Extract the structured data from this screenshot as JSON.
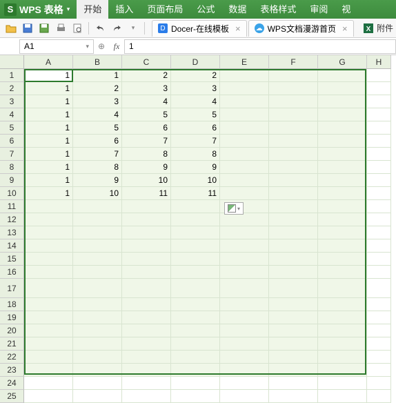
{
  "app": {
    "logo_letter": "S",
    "name": "WPS 表格",
    "dropdown": "▾"
  },
  "menu": [
    "开始",
    "插入",
    "页面布局",
    "公式",
    "数据",
    "表格样式",
    "审阅",
    "视"
  ],
  "toolbar_icons": [
    "folder-open",
    "save",
    "save-as",
    "print",
    "print-preview",
    "undo",
    "redo"
  ],
  "doc_tabs": [
    {
      "icon_bg": "#2b7de9",
      "icon_text": "D",
      "label": "Docer-在线模板",
      "close": "×"
    },
    {
      "icon_bg": "#3aa3e8",
      "icon_text": "☁",
      "label": "WPS文档漫游首页",
      "close": "×"
    }
  ],
  "attach_label": "附件",
  "namebox": {
    "value": "A1",
    "dd": "▾"
  },
  "fx_label": "fx",
  "formula_value": "1",
  "columns": [
    "A",
    "B",
    "C",
    "D",
    "E",
    "F",
    "G",
    "H"
  ],
  "row_numbers": [
    1,
    2,
    3,
    4,
    5,
    6,
    7,
    8,
    9,
    10,
    11,
    12,
    13,
    14,
    15,
    16,
    17,
    18,
    19,
    20,
    21,
    22,
    23,
    24,
    25
  ],
  "tall_row": 17,
  "cells": {
    "1": {
      "A": 1,
      "B": 1,
      "C": 2,
      "D": 2
    },
    "2": {
      "A": 1,
      "B": 2,
      "C": 3,
      "D": 3
    },
    "3": {
      "A": 1,
      "B": 3,
      "C": 4,
      "D": 4
    },
    "4": {
      "A": 1,
      "B": 4,
      "C": 5,
      "D": 5
    },
    "5": {
      "A": 1,
      "B": 5,
      "C": 6,
      "D": 6
    },
    "6": {
      "A": 1,
      "B": 6,
      "C": 7,
      "D": 7
    },
    "7": {
      "A": 1,
      "B": 7,
      "C": 8,
      "D": 8
    },
    "8": {
      "A": 1,
      "B": 8,
      "C": 9,
      "D": 9
    },
    "9": {
      "A": 1,
      "B": 9,
      "C": 10,
      "D": 10
    },
    "10": {
      "A": 1,
      "B": 10,
      "C": 11,
      "D": 11
    }
  },
  "paste_dd": "▾"
}
